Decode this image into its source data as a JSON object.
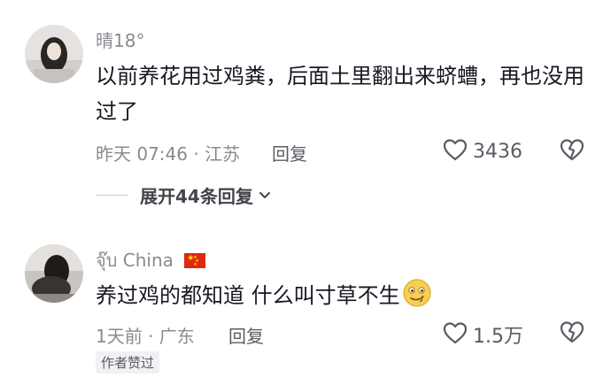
{
  "comments": [
    {
      "username": "晴18°",
      "text": "以前养花用过鸡粪，后面土里翻出来蛴螬，再也没用过了",
      "time_location": "昨天 07:46 · 江苏",
      "reply_label": "回复",
      "like_count": "3436",
      "expand_replies": "展开44条回复"
    },
    {
      "username": "จุ๊บ China",
      "country_flag": "China",
      "text": "养过鸡的都知道 什么叫寸草不生",
      "emoji_icon": "smirk-emoji",
      "time_location": "1天前 · 广东",
      "reply_label": "回复",
      "like_count": "1.5万",
      "badge": "作者赞过"
    }
  ],
  "colors": {
    "text_primary": "#161823",
    "text_secondary": "#8a8b91",
    "badge_bg": "#f1f1f3"
  }
}
